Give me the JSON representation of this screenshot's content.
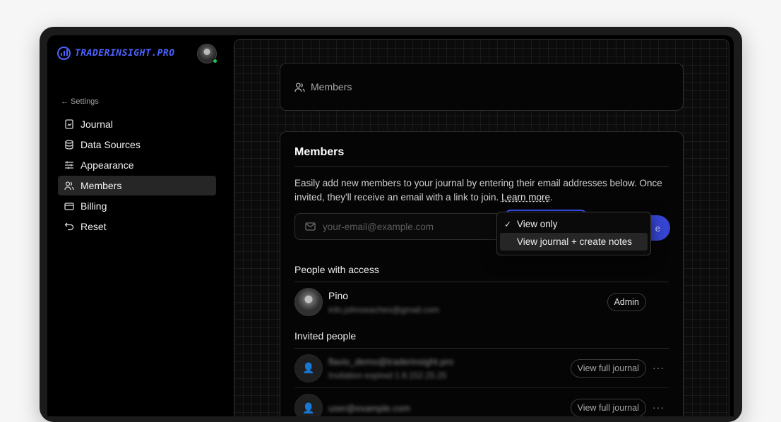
{
  "brand": {
    "name": "TRADERINSIGHT.PRO",
    "color": "#4d63ff"
  },
  "sidebar": {
    "back_label": "← Settings",
    "items": [
      {
        "label": "Journal",
        "icon": "journal-icon"
      },
      {
        "label": "Data Sources",
        "icon": "database-icon"
      },
      {
        "label": "Appearance",
        "icon": "sliders-icon"
      },
      {
        "label": "Members",
        "icon": "users-icon",
        "active": true
      },
      {
        "label": "Billing",
        "icon": "credit-card-icon"
      },
      {
        "label": "Reset",
        "icon": "undo-icon"
      }
    ]
  },
  "header": {
    "title": "Members"
  },
  "members": {
    "title": "Members",
    "description": "Easily add new members to your journal by entering their email addresses below. Once invited, they'll receive an email with a link to join.",
    "learn_more": "Learn more",
    "email_placeholder": "your-email@example.com",
    "invite_label_fragment": "e",
    "dropdown": [
      {
        "label": "View only",
        "checked": true
      },
      {
        "label": "View journal + create notes",
        "highlighted": true
      }
    ],
    "people_title": "People with access",
    "people": [
      {
        "name": "Pino",
        "email": "info.johnseaches@gmail.com",
        "role": "Admin"
      }
    ],
    "invited_title": "Invited people",
    "invited": [
      {
        "email": "flavio_demo@traderinsight.pro",
        "status": "Invitation expired 1.8.152.25.25",
        "role": "View full journal"
      },
      {
        "email": "user@example.com",
        "status": "",
        "role": "View full journal"
      }
    ]
  }
}
